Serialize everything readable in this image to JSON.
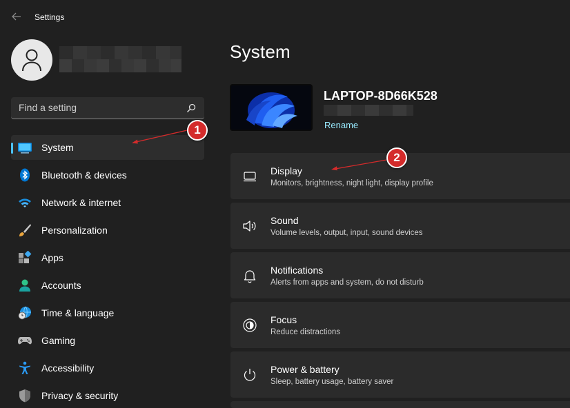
{
  "window": {
    "title": "Settings"
  },
  "sidebar": {
    "search_placeholder": "Find a setting",
    "items": [
      {
        "label": "System",
        "icon": "monitor-icon"
      },
      {
        "label": "Bluetooth & devices",
        "icon": "bluetooth-icon"
      },
      {
        "label": "Network & internet",
        "icon": "wifi-icon"
      },
      {
        "label": "Personalization",
        "icon": "brush-icon"
      },
      {
        "label": "Apps",
        "icon": "apps-icon"
      },
      {
        "label": "Accounts",
        "icon": "person-icon"
      },
      {
        "label": "Time & language",
        "icon": "globe-clock-icon"
      },
      {
        "label": "Gaming",
        "icon": "gamepad-icon"
      },
      {
        "label": "Accessibility",
        "icon": "accessibility-icon"
      },
      {
        "label": "Privacy & security",
        "icon": "shield-icon"
      }
    ]
  },
  "main": {
    "title": "System",
    "device": {
      "name": "LAPTOP-8D66K528",
      "rename_label": "Rename"
    },
    "cards": [
      {
        "title": "Display",
        "subtitle": "Monitors, brightness, night light, display profile",
        "icon": "display-icon"
      },
      {
        "title": "Sound",
        "subtitle": "Volume levels, output, input, sound devices",
        "icon": "speaker-icon"
      },
      {
        "title": "Notifications",
        "subtitle": "Alerts from apps and system, do not disturb",
        "icon": "bell-icon"
      },
      {
        "title": "Focus",
        "subtitle": "Reduce distractions",
        "icon": "focus-icon"
      },
      {
        "title": "Power & battery",
        "subtitle": "Sleep, battery usage, battery saver",
        "icon": "power-icon"
      }
    ]
  },
  "annotations": {
    "badge_1": "1",
    "badge_2": "2"
  },
  "colors": {
    "accent": "#4cc2ff",
    "link": "#99ebff",
    "annotation": "#d42b2b",
    "background": "#202020",
    "card": "#2b2b2b"
  }
}
